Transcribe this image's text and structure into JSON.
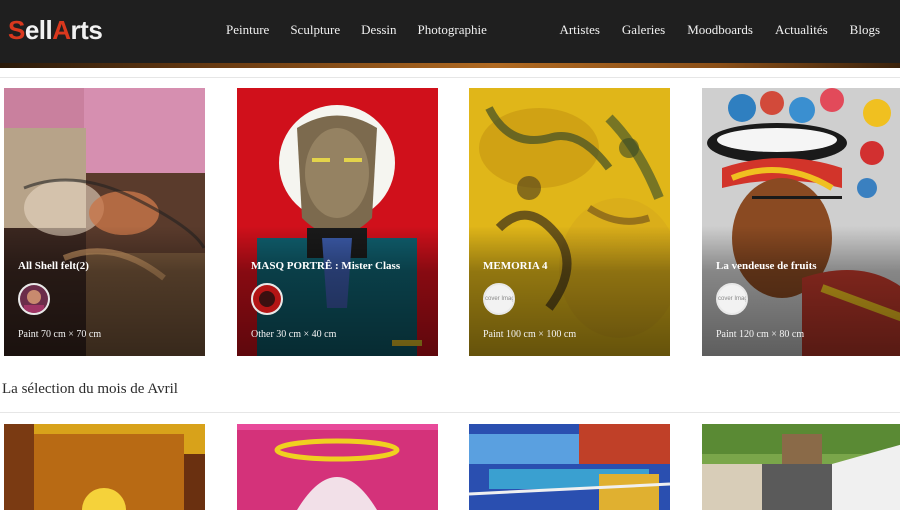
{
  "brand": {
    "name_pre": "",
    "name_s": "S",
    "name_mid": "ell",
    "name_a": "A",
    "name_post": "rts"
  },
  "nav": {
    "left": [
      "Peinture",
      "Sculpture",
      "Dessin",
      "Photographie"
    ],
    "right": [
      "Artistes",
      "Galeries",
      "Moodboards",
      "Actualités",
      "Blogs"
    ]
  },
  "featured": [
    {
      "title": "All Shell felt(2)",
      "meta": "Paint 70 cm × 70 cm",
      "avatar": "image"
    },
    {
      "title": "MASQ PORTRÊ : Mister Class",
      "meta": "Other 30 cm × 40 cm",
      "avatar": "image"
    },
    {
      "title": "MEMORIA 4",
      "meta": "Paint 100 cm × 100 cm",
      "avatar": "cover Imag"
    },
    {
      "title": "La vendeuse de fruits",
      "meta": "Paint 120 cm × 80 cm",
      "avatar": "cover Imag"
    }
  ],
  "section": {
    "title": "La sélection du mois de Avril"
  },
  "colors": {
    "navbar": "#1f1f1f",
    "accent_red": "#d9381e",
    "accent_bar": "#b06a22"
  }
}
